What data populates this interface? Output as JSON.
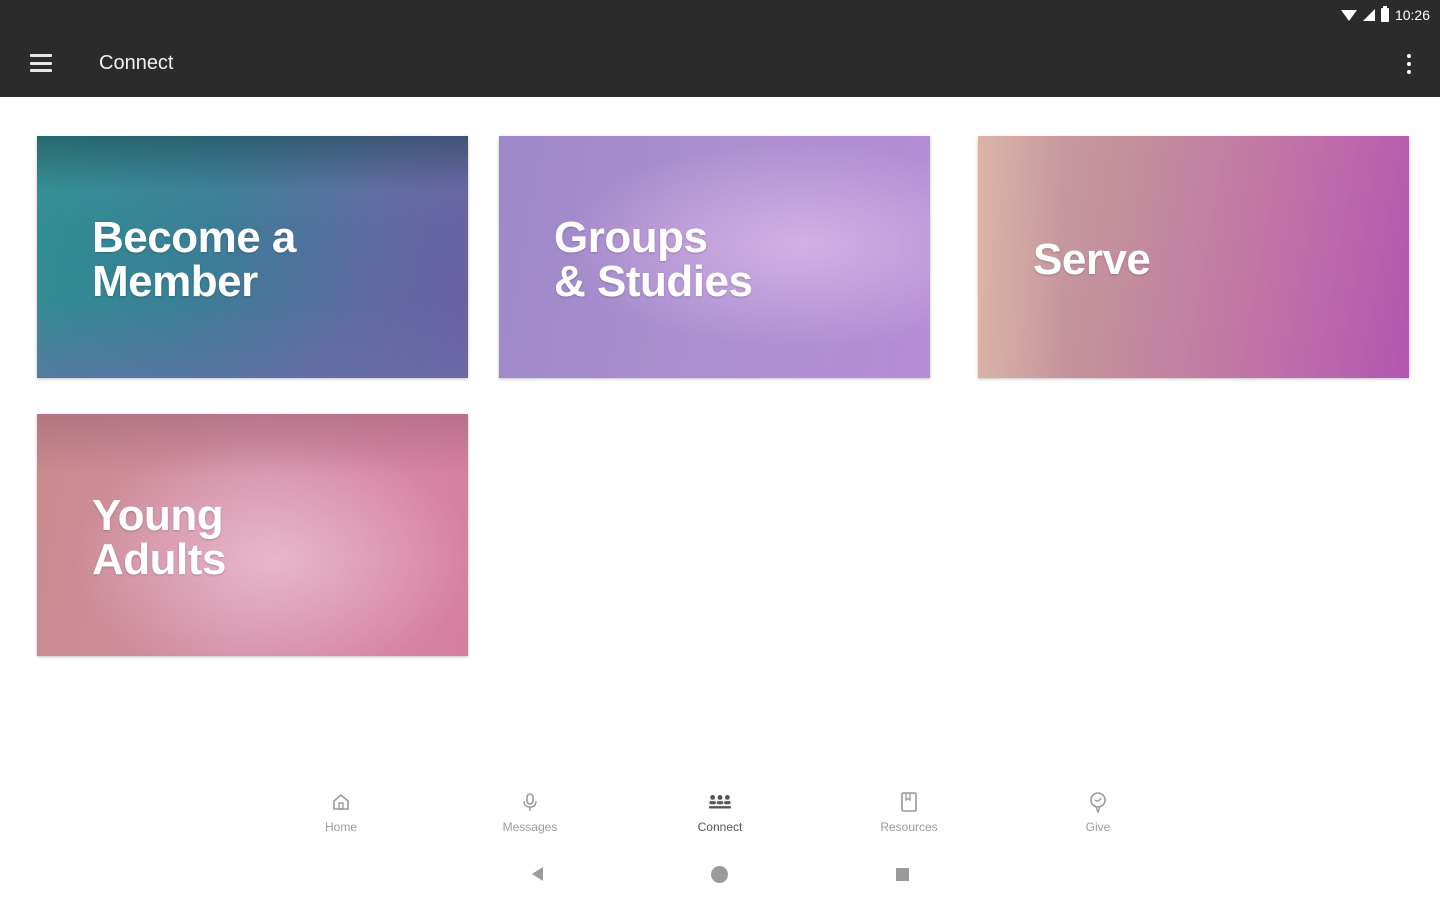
{
  "status_bar": {
    "time": "10:26"
  },
  "app_bar": {
    "title": "Connect"
  },
  "cards": [
    {
      "line1": "Become a",
      "line2": "Member"
    },
    {
      "line1": "Groups",
      "line2": "& Studies"
    },
    {
      "line1": "Serve"
    },
    {
      "line1": "Young",
      "line2": "Adults"
    }
  ],
  "bottom_nav": {
    "items": [
      {
        "label": "Home",
        "icon": "home-icon"
      },
      {
        "label": "Messages",
        "icon": "microphone-icon"
      },
      {
        "label": "Connect",
        "icon": "people-icon",
        "active": true
      },
      {
        "label": "Resources",
        "icon": "book-icon"
      },
      {
        "label": "Give",
        "icon": "give-icon"
      }
    ]
  },
  "colors": {
    "app_bar": "#2b2b2b",
    "nav_label": "#9a9a9a",
    "nav_label_active": "#555555"
  }
}
